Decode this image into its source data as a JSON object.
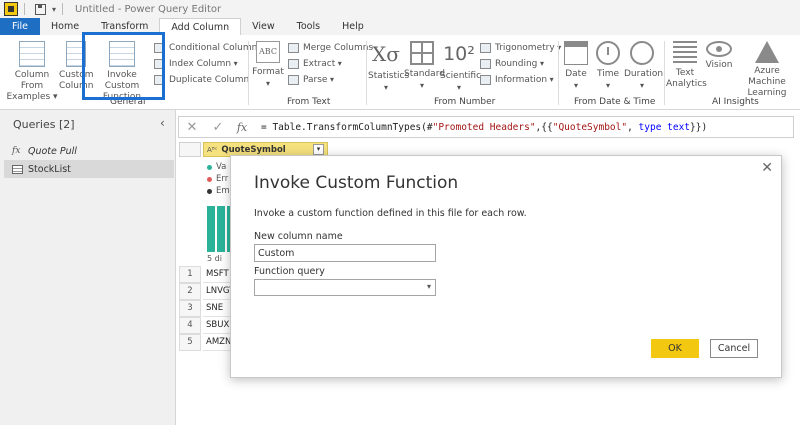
{
  "window": {
    "title": "Untitled - Power Query Editor",
    "qa_arrow": "▾"
  },
  "ribbon_tabs": [
    "File",
    "Home",
    "Transform",
    "Add Column",
    "View",
    "Tools",
    "Help"
  ],
  "ribbon": {
    "general": {
      "column_from_examples": "Column From Examples ▾",
      "custom_column": "Custom Column",
      "invoke_custom_function": "Invoke Custom Function",
      "conditional_column": "Conditional Column",
      "index_column": "Index Column",
      "duplicate_column": "Duplicate Column",
      "label": "General"
    },
    "from_text": {
      "format": "Format",
      "merge_columns": "Merge Columns",
      "extract": "Extract",
      "parse": "Parse",
      "label": "From Text"
    },
    "from_number": {
      "statistics": "Statistics",
      "standard": "Standard",
      "scientific": "Scientific",
      "trigonometry": "Trigonometry",
      "rounding": "Rounding",
      "information": "Information",
      "label": "From Number",
      "sigma_glyph": "Xσ",
      "ten_glyph": "10²"
    },
    "from_date_time": {
      "date": "Date",
      "time": "Time",
      "duration": "Duration",
      "label": "From Date & Time"
    },
    "ai_insights": {
      "text_analytics": "Text Analytics",
      "vision": "Vision",
      "azure_ml": "Azure Machine Learning",
      "label": "AI Insights"
    }
  },
  "formula_bar": {
    "cancel": "✕",
    "commit": "✓",
    "fx": "fx",
    "formula_prefix": "= Table.TransformColumnTypes(#",
    "formula_str1": "\"Promoted Headers\"",
    "formula_mid": ",{{",
    "formula_str2": "\"QuoteSymbol\"",
    "formula_sep": ", ",
    "formula_kw": "type text",
    "formula_end": "}})"
  },
  "queries": {
    "title": "Queries [2]",
    "collapse": "‹",
    "items": [
      {
        "label": "Quote Pull",
        "type": "function"
      },
      {
        "label": "StockList",
        "type": "table"
      }
    ]
  },
  "grid": {
    "column_header": "QuoteSymbol",
    "column_type": "Aᴮᶜ",
    "dropdown": "▾",
    "profile": {
      "valid": "Va",
      "error": "Err",
      "empty": "Em",
      "distinct": "5 di",
      "colors": {
        "valid": "#2bb39a",
        "error": "#e05c5c",
        "empty": "#333333"
      }
    },
    "rows": [
      {
        "n": "1",
        "value": "MSFT"
      },
      {
        "n": "2",
        "value": "LNVGY"
      },
      {
        "n": "3",
        "value": "SNE"
      },
      {
        "n": "4",
        "value": "SBUX"
      },
      {
        "n": "5",
        "value": "AMZN"
      }
    ]
  },
  "dialog": {
    "title": "Invoke Custom Function",
    "description": "Invoke a custom function defined in this file for each row.",
    "new_column_label": "New column name",
    "new_column_value": "Custom",
    "function_query_label": "Function query",
    "function_query_value": "",
    "close": "✕",
    "ok": "OK",
    "cancel": "Cancel"
  },
  "colors": {
    "file_tab": "#1e6fc4",
    "highlight": "#1b6fd1",
    "ok_button": "#f2c811",
    "column_header": "#f5e17d"
  }
}
